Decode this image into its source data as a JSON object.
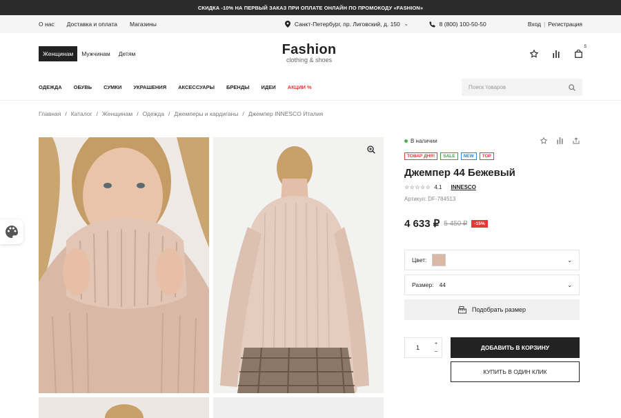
{
  "promo": "СКИДКА -10% НА ПЕРВЫЙ ЗАКАЗ ПРИ ОПЛАТЕ ОНЛАЙН ПО ПРОМОКОДУ «FASHION»",
  "topbar": {
    "links": [
      "О нас",
      "Доставка и оплата",
      "Магазины"
    ],
    "location": "Санкт-Петербург, пр. Лиговский, д. 150",
    "phone": "8 (800) 100-50-50",
    "login": "Вход",
    "sep": "|",
    "register": "Регистрация"
  },
  "header": {
    "gender": [
      "Женщинам",
      "Мужчинам",
      "Детям"
    ],
    "logo_title": "Fashion",
    "logo_sub": "clothing & shoes",
    "cart_count": "5"
  },
  "nav": {
    "items": [
      "ОДЕЖДА",
      "ОБУВЬ",
      "СУМКИ",
      "УКРАШЕНИЯ",
      "АКСЕССУАРЫ",
      "БРЕНДЫ",
      "ИДЕИ"
    ],
    "sale": "АКЦИИ %",
    "search_placeholder": "Поиск товаров"
  },
  "breadcrumbs": [
    "Главная",
    "Каталог",
    "Женщинам",
    "Одежда",
    "Джемперы и кардиганы",
    "Джемпер INNESCO Италия"
  ],
  "product": {
    "stock": "В наличии",
    "badges": [
      {
        "label": "ТОВАР ДНЯ!",
        "color": "#e53935"
      },
      {
        "label": "SALE",
        "color": "#43a047"
      },
      {
        "label": "NEW",
        "color": "#1e88e5"
      },
      {
        "label": "TOP",
        "color": "#e53935"
      }
    ],
    "title": "Джемпер 44 Бежевый",
    "stars": "☆☆☆☆☆",
    "rating": "4.1",
    "brand": "INNESCO",
    "sku": "Артикул: DF-784513",
    "price": "4 633 ₽",
    "old_price": "5 450 ₽",
    "discount": "-15%",
    "color_label": "Цвет:",
    "size_label": "Размер:",
    "size_value": "44",
    "size_button": "Подобрать размер",
    "qty": "1",
    "add_to_cart": "ДОБАВИТЬ В КОРЗИНУ",
    "buy_one_click": "КУПИТЬ В ОДИН КЛИК"
  },
  "colors": {
    "accent": "#222222",
    "sale": "#e53935",
    "stock": "#4caf50"
  }
}
